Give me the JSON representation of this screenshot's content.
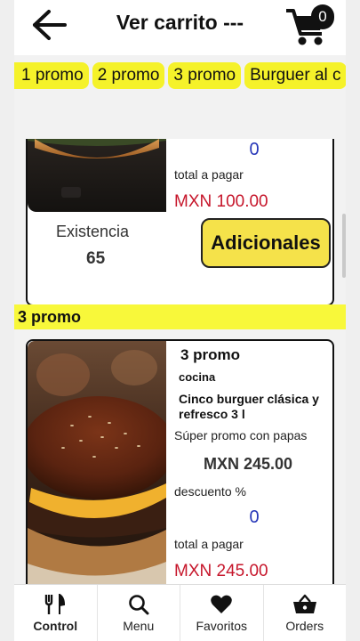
{
  "header": {
    "title": "Ver carrito ---",
    "cart_count": "0"
  },
  "categories": [
    "1 promo",
    "2 promo",
    "3 promo",
    "Burguer al c"
  ],
  "product_1": {
    "discount_value": "0",
    "total_label": "total a pagar",
    "total_value": "MXN 100.00",
    "stock_label": "Existencia",
    "stock_value": "65",
    "add_button": "Adicionales"
  },
  "section_title": "3 promo",
  "product_2": {
    "name": "3 promo",
    "area": "cocina",
    "description": "Cinco burguer clásica y refresco 3 l",
    "promo_text": "Súper promo con papas",
    "price": "MXN 245.00",
    "discount_label": "descuento %",
    "discount_value": "0",
    "total_label": "total a pagar",
    "total_value": "MXN 245.00"
  },
  "nav": {
    "items": [
      {
        "label": "Control",
        "icon": "fork-knife-icon",
        "active": true
      },
      {
        "label": "Menu",
        "icon": "search-icon",
        "active": false
      },
      {
        "label": "Favoritos",
        "icon": "heart-icon",
        "active": false
      },
      {
        "label": "Orders",
        "icon": "basket-icon",
        "active": false
      }
    ]
  }
}
